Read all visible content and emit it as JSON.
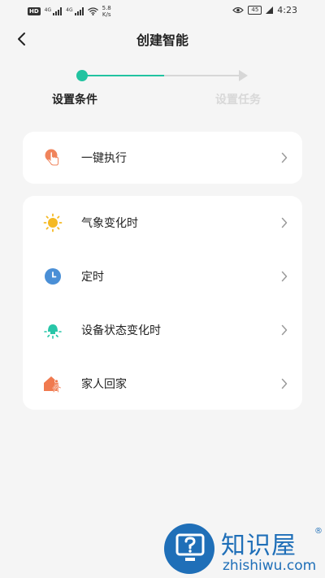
{
  "status_bar": {
    "hd": "HD",
    "net1": "4G",
    "net2": "4G",
    "speed_value": "5.8",
    "speed_unit": "K/s",
    "battery": "45",
    "time": "4:23"
  },
  "header": {
    "title": "创建智能"
  },
  "stepper": {
    "step1_label": "设置条件",
    "step2_label": "设置任务",
    "active_color": "#22c3a0",
    "inactive_color": "#d7d7d7"
  },
  "card_manual": {
    "items": [
      {
        "label": "一键执行",
        "icon": "tap-hand-icon"
      }
    ]
  },
  "card_conditions": {
    "items": [
      {
        "label": "气象变化时",
        "icon": "sun-icon"
      },
      {
        "label": "定时",
        "icon": "clock-icon"
      },
      {
        "label": "设备状态变化时",
        "icon": "device-light-icon"
      },
      {
        "label": "家人回家",
        "icon": "home-person-icon"
      }
    ]
  },
  "watermark": {
    "name": "知识屋",
    "reg": "®",
    "url": "zhishiwu.com",
    "color": "#1f6fb8"
  }
}
